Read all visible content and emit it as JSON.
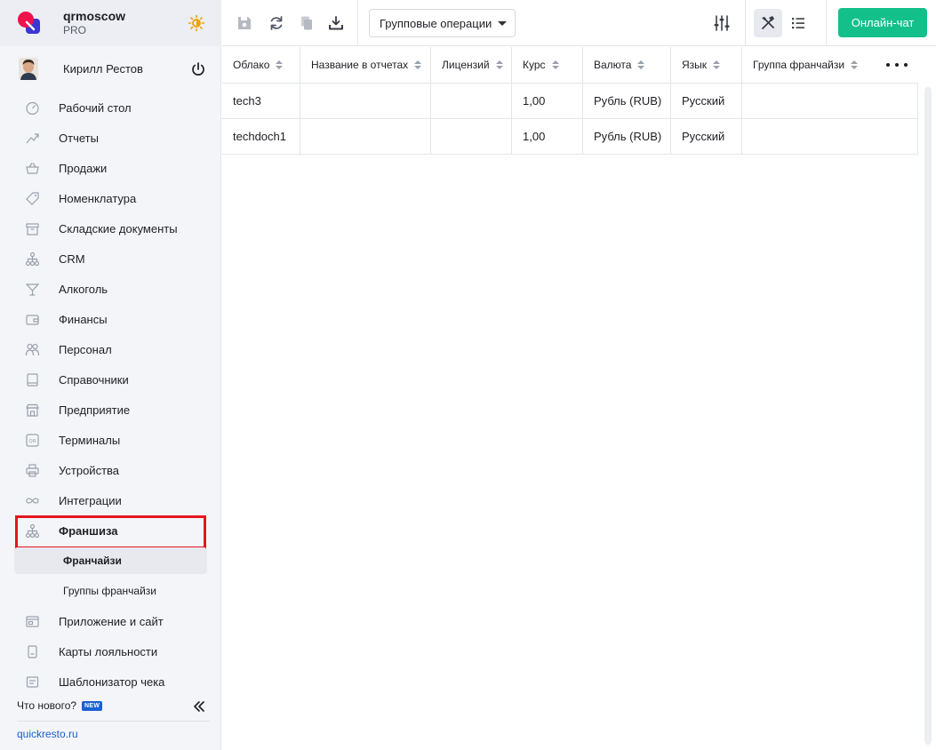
{
  "brand": {
    "name": "qrmoscow",
    "plan": "PRO"
  },
  "user": {
    "name": "Кирилл Рестов"
  },
  "nav": {
    "items": [
      {
        "label": "Рабочий стол",
        "icon": "dashboard-icon"
      },
      {
        "label": "Отчеты",
        "icon": "chart-icon"
      },
      {
        "label": "Продажи",
        "icon": "basket-icon"
      },
      {
        "label": "Номенклатура",
        "icon": "tag-icon"
      },
      {
        "label": "Складские документы",
        "icon": "archive-icon"
      },
      {
        "label": "CRM",
        "icon": "hierarchy-icon"
      },
      {
        "label": "Алкоголь",
        "icon": "cocktail-icon"
      },
      {
        "label": "Финансы",
        "icon": "wallet-icon"
      },
      {
        "label": "Персонал",
        "icon": "people-icon"
      },
      {
        "label": "Справочники",
        "icon": "book-icon"
      },
      {
        "label": "Предприятие",
        "icon": "store-icon"
      },
      {
        "label": "Терминалы",
        "icon": "qr-icon"
      },
      {
        "label": "Устройства",
        "icon": "printer-icon"
      },
      {
        "label": "Интеграции",
        "icon": "infinity-icon"
      },
      {
        "label": "Франшиза",
        "icon": "hierarchy-icon"
      }
    ],
    "sub_items": [
      {
        "label": "Франчайзи"
      },
      {
        "label": "Группы франчайзи"
      }
    ],
    "items_after": [
      {
        "label": "Приложение и сайт",
        "icon": "app-icon"
      },
      {
        "label": "Карты лояльности",
        "icon": "card-icon"
      },
      {
        "label": "Шаблонизатор чека",
        "icon": "receipt-icon"
      }
    ]
  },
  "footer": {
    "whats_new": "Что нового?",
    "badge": "NEW",
    "site": "quickresto.ru"
  },
  "toolbar": {
    "group_ops": "Групповые операции",
    "chat": "Онлайн-чат"
  },
  "table": {
    "headers": [
      "Облако",
      "Название в отчетах",
      "Лицензий",
      "Курс",
      "Валюта",
      "Язык",
      "Группа франчайзи"
    ],
    "rows": [
      [
        "tech3",
        "",
        "",
        "1,00",
        "Рубль (RUB)",
        "Русский",
        ""
      ],
      [
        "techdoch1",
        "",
        "",
        "1,00",
        "Рубль (RUB)",
        "Русский",
        ""
      ]
    ]
  },
  "colors": {
    "accent_green": "#13c08a",
    "highlight_red": "#e4161f",
    "link_blue": "#1a5fd6"
  }
}
